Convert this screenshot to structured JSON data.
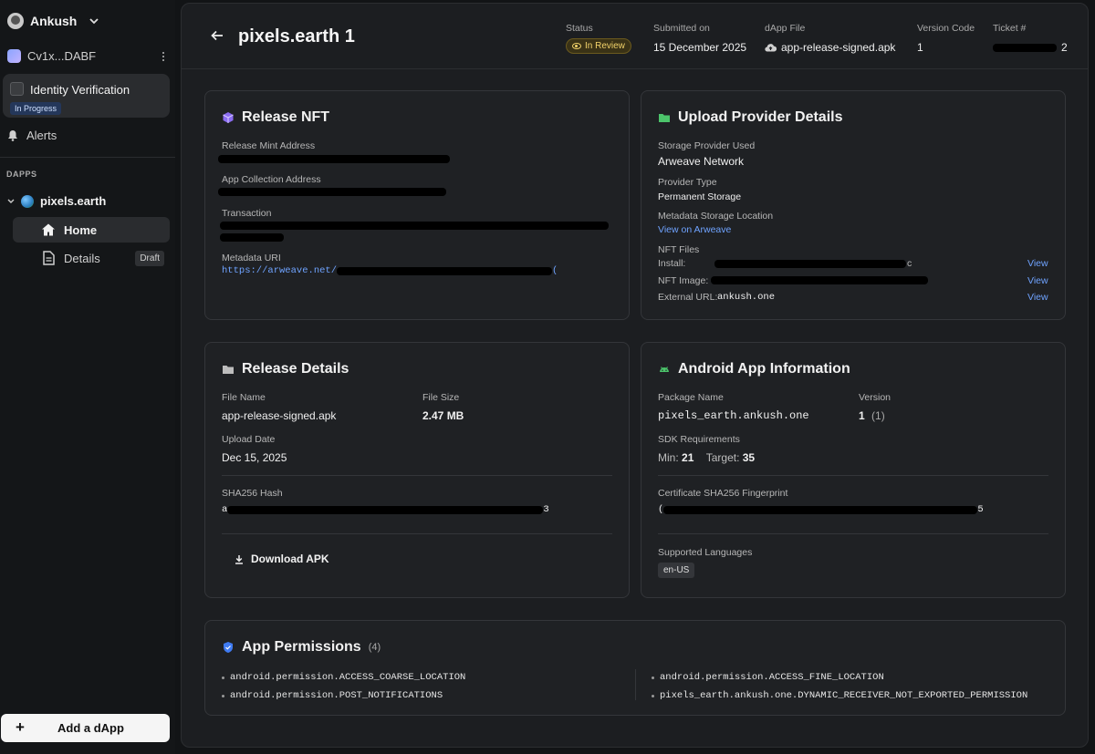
{
  "sidebar": {
    "user_name": "Ankush",
    "wallet_label": "Cv1x...DABF",
    "identity": {
      "title": "Identity Verification",
      "status": "In Progress"
    },
    "alerts_label": "Alerts",
    "section_label": "DAPPS",
    "dapp_name": "pixels.earth",
    "nav": {
      "home": "Home",
      "details": "Details",
      "details_badge": "Draft"
    },
    "add_dapp": "Add a dApp"
  },
  "header": {
    "title": "pixels.earth 1",
    "status_label": "Status",
    "status_value": "In Review",
    "submitted_label": "Submitted on",
    "submitted_value": "15 December 2025",
    "file_label": "dApp File",
    "file_value": "app-release-signed.apk",
    "version_label": "Version Code",
    "version_value": "1",
    "ticket_label": "Ticket #",
    "ticket_value_tail": "2"
  },
  "release_nft": {
    "title": "Release NFT",
    "mint_label": "Release Mint Address",
    "collection_label": "App Collection Address",
    "transaction_label": "Transaction",
    "metadata_label": "Metadata URI",
    "metadata_prefix": "https://arweave.net/",
    "metadata_suffix": "("
  },
  "upload_provider": {
    "title": "Upload Provider Details",
    "storage_label": "Storage Provider Used",
    "storage_value": "Arweave Network",
    "type_label": "Provider Type",
    "type_value": "Permanent Storage",
    "location_label": "Metadata Storage Location",
    "location_link": "View on Arweave",
    "nft_files_label": "NFT Files",
    "install_label": "Install:",
    "install_tail": "c",
    "image_label": "NFT Image:",
    "external_label": "External URL:",
    "external_value": "ankush.one",
    "view_label": "View"
  },
  "release_details": {
    "title": "Release Details",
    "file_name_label": "File Name",
    "file_name_value": "app-release-signed.apk",
    "file_size_label": "File Size",
    "file_size_value": "2.47 MB",
    "upload_date_label": "Upload Date",
    "upload_date_value": "Dec 15, 2025",
    "hash_label": "SHA256 Hash",
    "hash_head": "a",
    "hash_tail": "3",
    "download_label": "Download APK"
  },
  "android_info": {
    "title": "Android App Information",
    "package_label": "Package Name",
    "package_value": "pixels_earth.ankush.one",
    "version_label": "Version",
    "version_value": "1",
    "version_code": "(1)",
    "sdk_label": "SDK Requirements",
    "sdk_min_label": "Min:",
    "sdk_min_value": "21",
    "sdk_target_label": "Target:",
    "sdk_target_value": "35",
    "cert_label": "Certificate SHA256 Fingerprint",
    "cert_head": "(",
    "cert_tail": "5",
    "languages_label": "Supported Languages",
    "language": "en-US"
  },
  "permissions": {
    "title": "App Permissions",
    "count": "(4)",
    "items": [
      "android.permission.ACCESS_COARSE_LOCATION",
      "android.permission.ACCESS_FINE_LOCATION",
      "android.permission.POST_NOTIFICATIONS",
      "pixels_earth.ankush.one.DYNAMIC_RECEIVER_NOT_EXPORTED_PERMISSION"
    ]
  },
  "colors": {
    "accent_link": "#6fa3ff",
    "status_in_review": "#f3d36a",
    "in_progress_badge": "#24375a"
  },
  "icons": [
    "chevron-down-icon",
    "kebab-icon",
    "bell-icon",
    "home-icon",
    "document-icon",
    "plus-icon",
    "back-arrow-icon",
    "eye-icon",
    "cloud-upload-icon",
    "cube-icon",
    "folder-icon",
    "android-icon",
    "shield-icon",
    "download-icon"
  ]
}
